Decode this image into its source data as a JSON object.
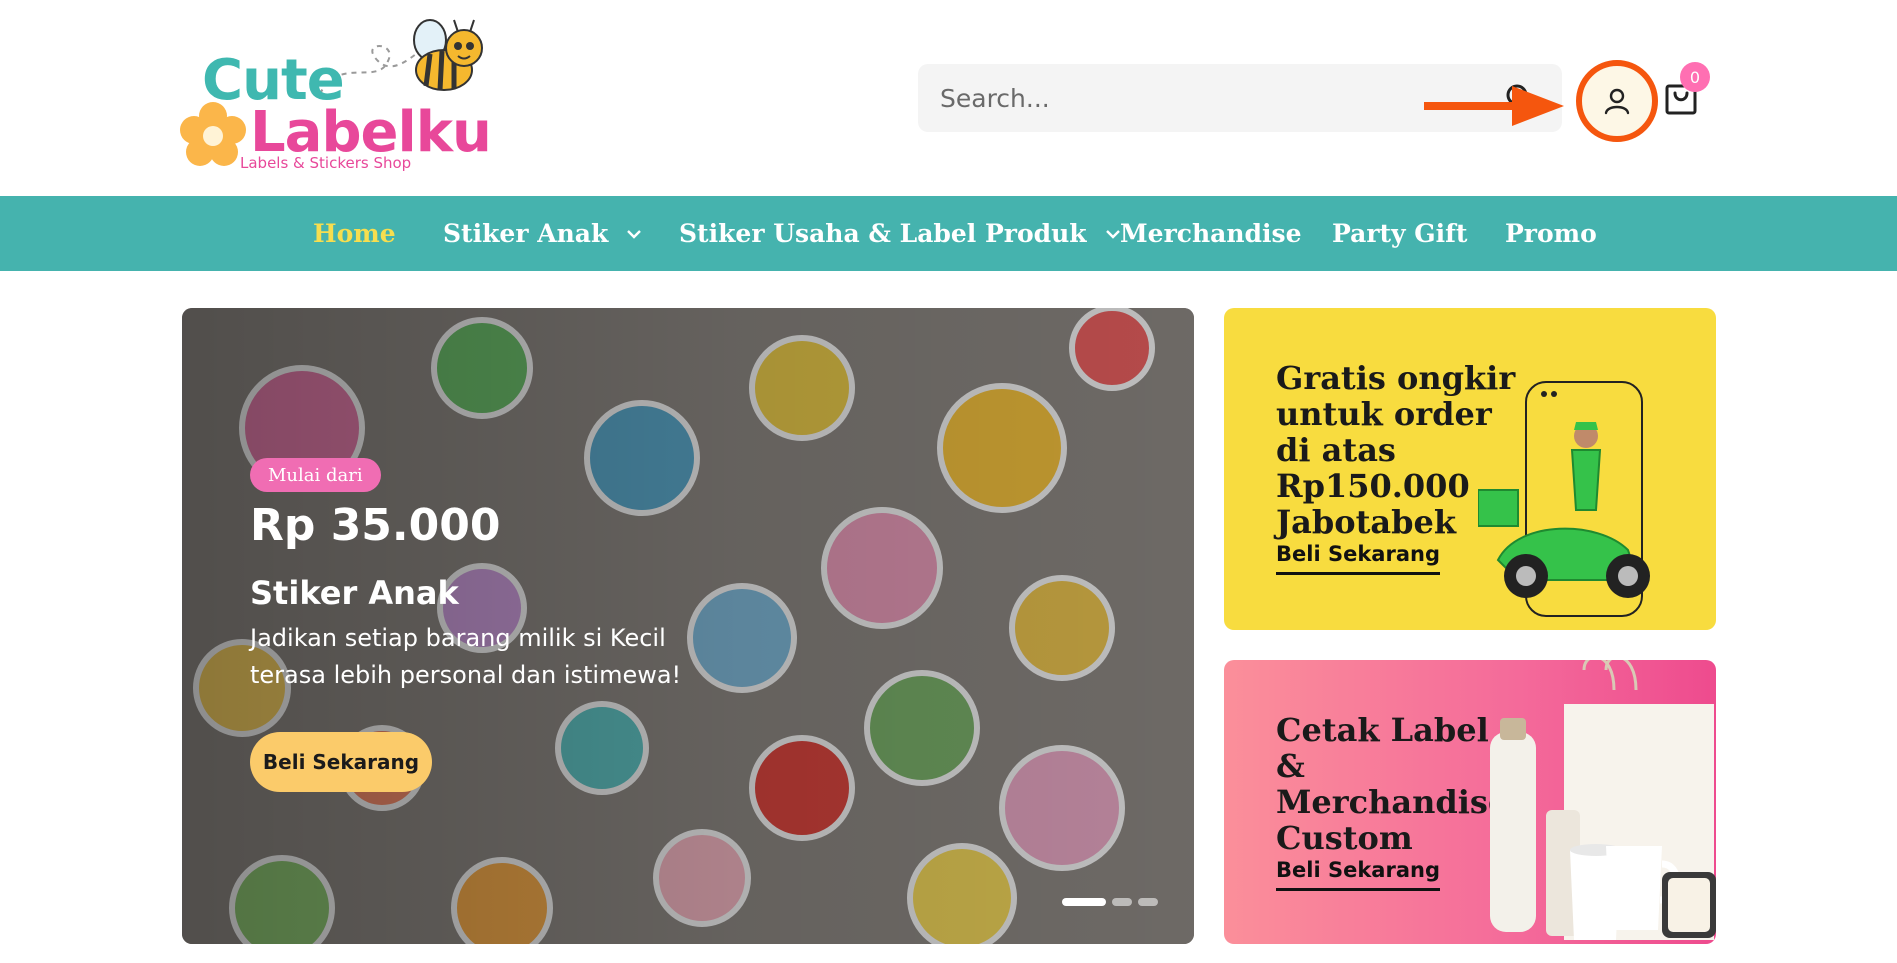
{
  "header": {
    "logo": {
      "word1": "Cute",
      "word2": "Labelku",
      "tagline": "Labels & Stickers Shop"
    },
    "search": {
      "placeholder": "Search...",
      "icon": "search-icon"
    },
    "account_icon": "user-icon",
    "cart": {
      "icon": "shopping-bag-icon",
      "count": "0"
    },
    "highlight_color": "#f5560e"
  },
  "nav": {
    "items": [
      {
        "label": "Home",
        "active": true,
        "dropdown": false
      },
      {
        "label": "Stiker Anak",
        "active": false,
        "dropdown": true
      },
      {
        "label": "Stiker Usaha & Label Produk",
        "active": false,
        "dropdown": true
      },
      {
        "label": "Merchandise",
        "active": false,
        "dropdown": false
      },
      {
        "label": "Party Gift",
        "active": false,
        "dropdown": false
      },
      {
        "label": "Promo",
        "active": false,
        "dropdown": false
      }
    ],
    "background": "#45b3ae",
    "active_color": "#f6de4f"
  },
  "hero": {
    "badge": "Mulai dari",
    "price": "Rp 35.000",
    "title": "Stiker Anak",
    "description": "Jadikan setiap barang milik si Kecil terasa lebih personal dan istimewa!",
    "button": "Beli Sekarang",
    "slides": 3,
    "active_slide": 1
  },
  "promos": [
    {
      "title": "Gratis ongkir untuk order di atas Rp150.000 Jabotabek",
      "link": "Beli Sekarang",
      "background": "#f8dc3f"
    },
    {
      "title": "Cetak Label & Merchandise Custom",
      "link": "Beli Sekarang",
      "background": "#f46a9a"
    }
  ]
}
